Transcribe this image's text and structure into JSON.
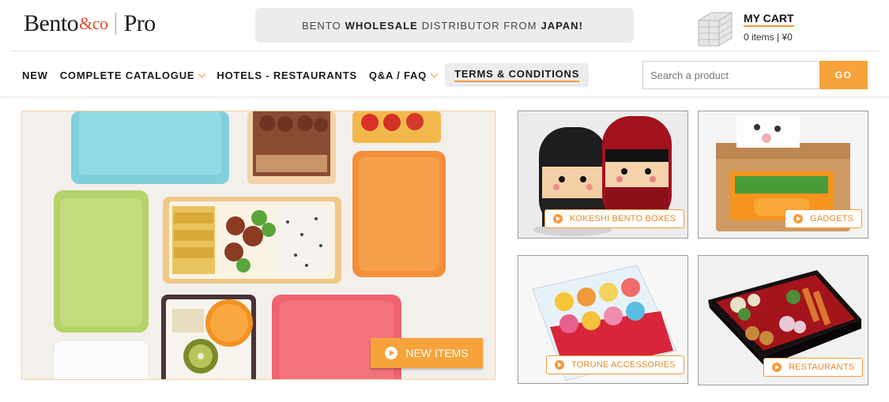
{
  "header": {
    "logo": {
      "brand": "Bento",
      "amp": "&co",
      "suffix": "Pro"
    },
    "promo": {
      "pre": "BENTO",
      "bold1": "WHOLESALE",
      "mid": "DISTRIBUTOR FROM",
      "bold2": "JAPAN!"
    },
    "cart": {
      "title": "MY CART",
      "summary": "0 items | ¥0",
      "icon": "boxes-stack-icon"
    }
  },
  "nav": {
    "items": [
      {
        "label": "NEW",
        "dropdown": false
      },
      {
        "label": "COMPLETE CATALOGUE",
        "dropdown": true
      },
      {
        "label": "HOTELS - RESTAURANTS",
        "dropdown": false
      },
      {
        "label": "Q&A / FAQ",
        "dropdown": true
      }
    ],
    "terms_label": "TERMS & CONDITIONS"
  },
  "search": {
    "placeholder": "Search a product",
    "button_label": "GO"
  },
  "hero": {
    "button_label": "NEW ITEMS",
    "icon": "play-circle-icon"
  },
  "tiles": [
    {
      "label": "KOKESHI BENTO BOXES"
    },
    {
      "label": "GADGETS"
    },
    {
      "label": "TORUNE ACCESSORIES"
    },
    {
      "label": "RESTAURANTS"
    }
  ],
  "colors": {
    "accent": "#f5a33a",
    "accent_border": "#f39a3c",
    "promo_bg": "#ececec",
    "logo_amp": "#e14b2a"
  }
}
